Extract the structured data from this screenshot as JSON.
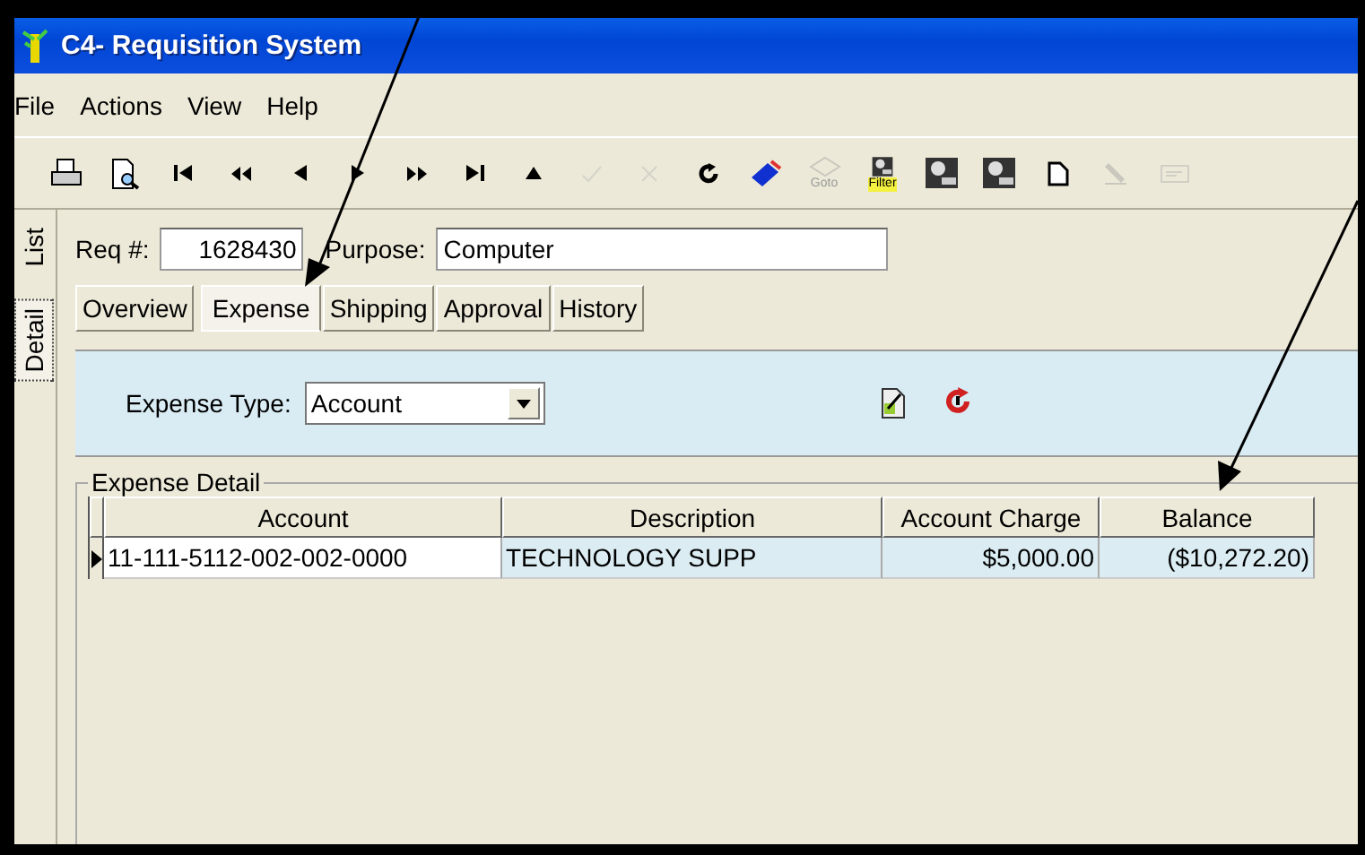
{
  "window": {
    "title": "C4- Requisition System"
  },
  "menu": [
    "File",
    "Actions",
    "View",
    "Help"
  ],
  "toolbar": [
    {
      "kind": "print",
      "disabled": false
    },
    {
      "kind": "preview",
      "disabled": false
    },
    {
      "kind": "first",
      "disabled": false
    },
    {
      "kind": "rewind",
      "disabled": false
    },
    {
      "kind": "prev",
      "disabled": false
    },
    {
      "kind": "next",
      "disabled": false
    },
    {
      "kind": "forward",
      "disabled": false
    },
    {
      "kind": "last",
      "disabled": false
    },
    {
      "kind": "up",
      "disabled": false
    },
    {
      "kind": "check",
      "disabled": true
    },
    {
      "kind": "cancel",
      "disabled": true
    },
    {
      "kind": "refresh",
      "disabled": false
    },
    {
      "kind": "book",
      "disabled": false
    },
    {
      "kind": "goto",
      "disabled": true,
      "label": "Goto"
    },
    {
      "kind": "filter",
      "disabled": false,
      "label": "Filter"
    },
    {
      "kind": "search",
      "disabled": false
    },
    {
      "kind": "search",
      "disabled": false
    },
    {
      "kind": "page",
      "disabled": false
    },
    {
      "kind": "tool",
      "disabled": true
    },
    {
      "kind": "card",
      "disabled": true
    }
  ],
  "side_tabs": [
    {
      "label": "List",
      "selected": false
    },
    {
      "label": "Detail",
      "selected": true
    }
  ],
  "req": {
    "label": "Req #:",
    "value": "1628430"
  },
  "purpose": {
    "label": "Purpose:",
    "value": "Computer"
  },
  "tabs": [
    {
      "label": "Overview",
      "selected": false
    },
    {
      "label": "Expense",
      "selected": true
    },
    {
      "label": "Shipping",
      "selected": false
    },
    {
      "label": "Approval",
      "selected": false
    },
    {
      "label": "History",
      "selected": false
    }
  ],
  "expense_type": {
    "label": "Expense Type:",
    "value": "Account"
  },
  "expense_detail": {
    "title": "Expense Detail",
    "columns": [
      "Account",
      "Description",
      "Account Charge",
      "Balance"
    ],
    "rows": [
      {
        "selected": true,
        "cells": [
          "11-111-5112-002-002-0000",
          "TECHNOLOGY SUPP",
          "$5,000.00",
          "($10,272.20)"
        ]
      }
    ]
  }
}
